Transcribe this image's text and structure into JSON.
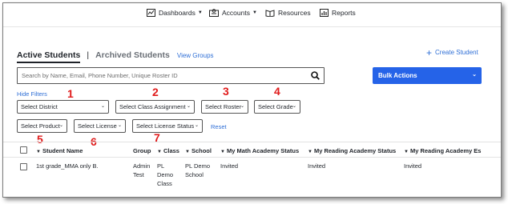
{
  "nav": {
    "dashboards": "Dashboards",
    "accounts": "Accounts",
    "resources": "Resources",
    "reports": "Reports"
  },
  "tabs": {
    "active": "Active Students",
    "separator": "|",
    "archived": "Archived Students",
    "view_groups": "View Groups"
  },
  "create_student": "Create Student",
  "search": {
    "placeholder": "Search by Name, Email, Phone Number, Unique Roster ID"
  },
  "bulk_actions": "Bulk Actions",
  "hide_filters": "Hide Filters",
  "filters": {
    "district": "Select District",
    "class_assignment": "Select Class Assignment",
    "roster": "Select Roster",
    "grade": "Select Grade",
    "product": "Select Product",
    "license": "Select License",
    "license_status": "Select License Status",
    "reset": "Reset"
  },
  "annotations": [
    "1",
    "2",
    "3",
    "4",
    "5",
    "6",
    "7"
  ],
  "table": {
    "headers": {
      "student_name": "Student Name",
      "group": "Group",
      "class": "Class",
      "school": "School",
      "math_status": "My Math Academy Status",
      "reading_status": "My Reading Academy Status",
      "reading_es": "My Reading Academy Es"
    },
    "rows": [
      {
        "student_name": "1st grade_MMA only B.",
        "group_l1": "Admin",
        "group_l2": "Test",
        "class_l1": "PL",
        "class_l2": "Demo",
        "class_l3": "Class",
        "school_l1": "PL Demo",
        "school_l2": "School",
        "math_status": "Invited",
        "reading_status": "Invited",
        "reading_es": "Invited"
      }
    ]
  },
  "colors": {
    "accent": "#2563e8",
    "link": "#2f6fd6",
    "annotation": "#e01b1b"
  }
}
